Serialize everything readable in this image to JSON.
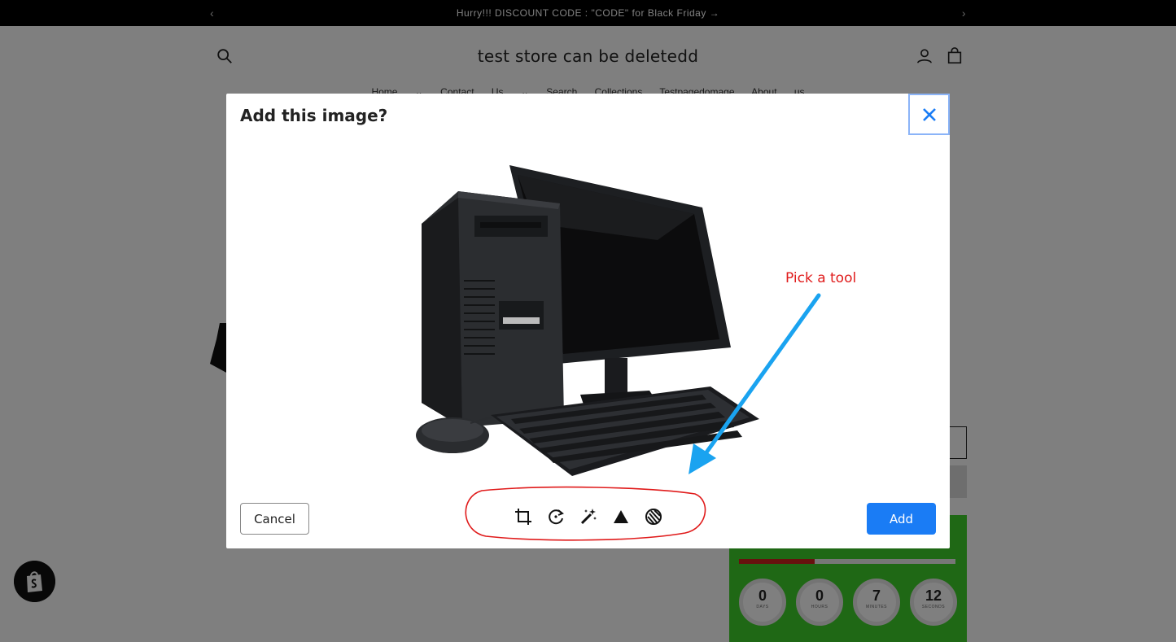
{
  "announcement": {
    "text": "Hurry!!! DISCOUNT CODE : \"CODE\" for Black Friday →",
    "prev_icon": "chevron-left-icon",
    "next_icon": "chevron-right-icon"
  },
  "store": {
    "title": "test store can be deletedd",
    "nav": "Home ⌄ Contact Us ⌄ Search Collections Testpagedomage About us"
  },
  "promo": {
    "progress": 0.35,
    "timers": [
      {
        "value": "0",
        "label": "DAYS"
      },
      {
        "value": "0",
        "label": "HOURS"
      },
      {
        "value": "7",
        "label": "MINUTES"
      },
      {
        "value": "12",
        "label": "SECONDS"
      }
    ]
  },
  "modal": {
    "title": "Add this image?",
    "close_icon": "close-icon",
    "cancel_label": "Cancel",
    "add_label": "Add",
    "tools": [
      "crop-icon",
      "rotate-icon",
      "magic-wand-icon",
      "triangle-icon",
      "fingerprint-icon"
    ]
  },
  "annotation": {
    "text": "Pick a tool"
  },
  "colors": {
    "accent": "#1a7cf5",
    "annotation_red": "#e01b1b",
    "arrow_blue": "#1aa3f0",
    "promo_green": "#3fd12a"
  }
}
